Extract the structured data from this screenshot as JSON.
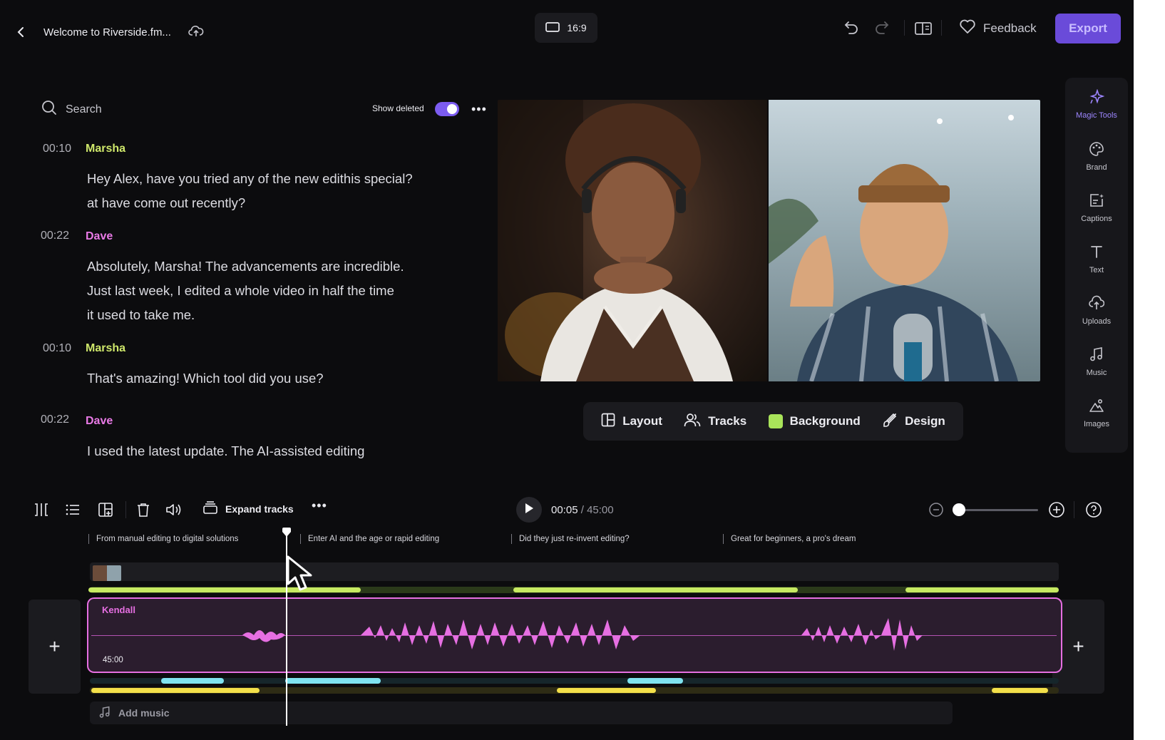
{
  "app": {
    "accent": "#6a4bd9",
    "highlight": "#e66fe2"
  },
  "header": {
    "title": "Welcome to Riverside.fm...",
    "aspect_ratio": "16:9",
    "feedback_label": "Feedback",
    "export_label": "Export",
    "icons": [
      "back-icon",
      "cloud-sync-icon",
      "undo-icon",
      "redo-icon",
      "split-view-icon",
      "heart-icon"
    ]
  },
  "transcript": {
    "search_placeholder": "Search",
    "show_deleted_label": "Show deleted",
    "show_deleted_on": true,
    "more_label": "•••",
    "entries": [
      {
        "time": "00:10",
        "speaker": "Marsha",
        "color": "#cfe86b",
        "text": "Hey Alex, have you tried any of the new edithis special?\nat have come out recently?"
      },
      {
        "time": "00:22",
        "speaker": "Dave",
        "color": "#e97ae6",
        "text": "Absolutely, Marsha! The advancements are incredible.\nJust last week, I edited a whole video in half the time\nit used to take me."
      },
      {
        "time": "00:10",
        "speaker": "Marsha",
        "color": "#cfe86b",
        "text": "That's amazing! Which tool did you use?"
      },
      {
        "time": "00:22",
        "speaker": "Dave",
        "color": "#e97ae6",
        "text": " I used the latest update. The AI-assisted editing"
      }
    ]
  },
  "preview_controls": {
    "layout_label": "Layout",
    "tracks_label": "Tracks",
    "background_label": "Background",
    "background_color": "#a9e45a",
    "design_label": "Design"
  },
  "sidebar_tools": [
    {
      "label": "Magic Tools",
      "icon": "magic-sparkle-icon",
      "active": true
    },
    {
      "label": "Brand",
      "icon": "palette-icon"
    },
    {
      "label": "Captions",
      "icon": "captions-icon"
    },
    {
      "label": "Text",
      "icon": "text-icon"
    },
    {
      "label": "Uploads",
      "icon": "upload-icon"
    },
    {
      "label": "Music",
      "icon": "music-note-icon"
    },
    {
      "label": "Images",
      "icon": "images-icon"
    }
  ],
  "timeline": {
    "expand_label": "Expand tracks",
    "more_label": "•••",
    "current_time": "00:05",
    "separator": " / ",
    "total_time": "45:00",
    "zoom_level": 0.0,
    "chapters": [
      "From manual editing to digital solutions",
      "Enter AI and the age or rapid editing",
      "Did they just re-invent editing?",
      "Great for beginners, a pro's dream"
    ],
    "audio_track": {
      "name": "Kendall",
      "duration": "45:00",
      "color": "#e66fe2"
    },
    "add_music_label": "Add music",
    "add_label": "+"
  }
}
